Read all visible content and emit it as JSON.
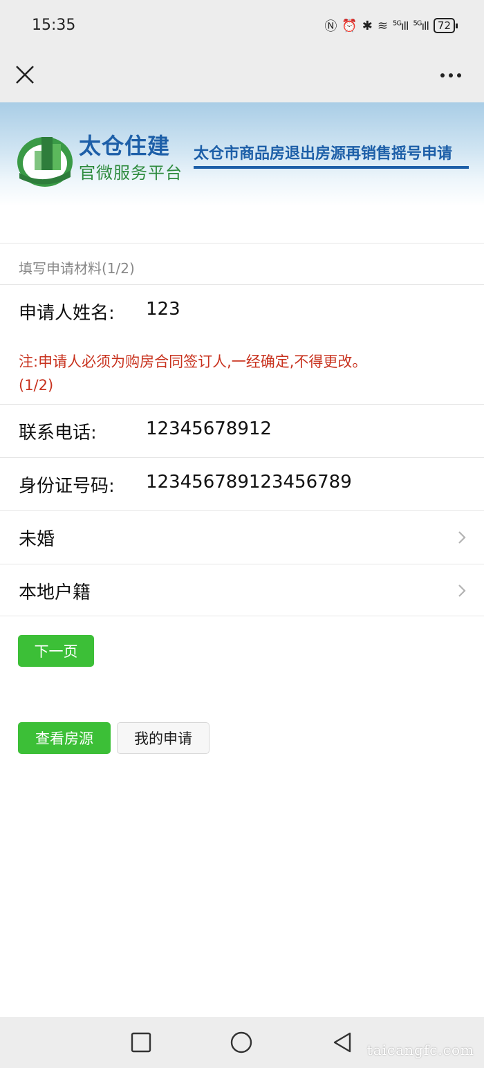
{
  "status_bar": {
    "time": "15:35",
    "signal1": "5G",
    "signal2": "5G",
    "battery": "72"
  },
  "banner": {
    "brand_title": "太仓住建",
    "brand_subtitle": "官微服务平台",
    "heading": "太仓市商品房退出房源再销售摇号申请"
  },
  "form": {
    "section_title": "填写申请材料(1/2)",
    "applicant_label": "申请人姓名:",
    "applicant_value": "123",
    "note_line1": "注:申请人必须为购房合同签订人,一经确定,不得更改。",
    "note_line2": "(1/2)",
    "phone_label": "联系电话:",
    "phone_value": "12345678912",
    "id_label": "身份证号码:",
    "id_value": "123456789123456789",
    "marital_status": "未婚",
    "household_type": "本地户籍"
  },
  "buttons": {
    "next_page": "下一页",
    "view_listings": "查看房源",
    "my_applications": "我的申请"
  },
  "watermark": "taicangfc.com",
  "colors": {
    "primary_green": "#3cbf37",
    "note_red": "#c8321e",
    "brand_blue": "#1d5fa8"
  }
}
